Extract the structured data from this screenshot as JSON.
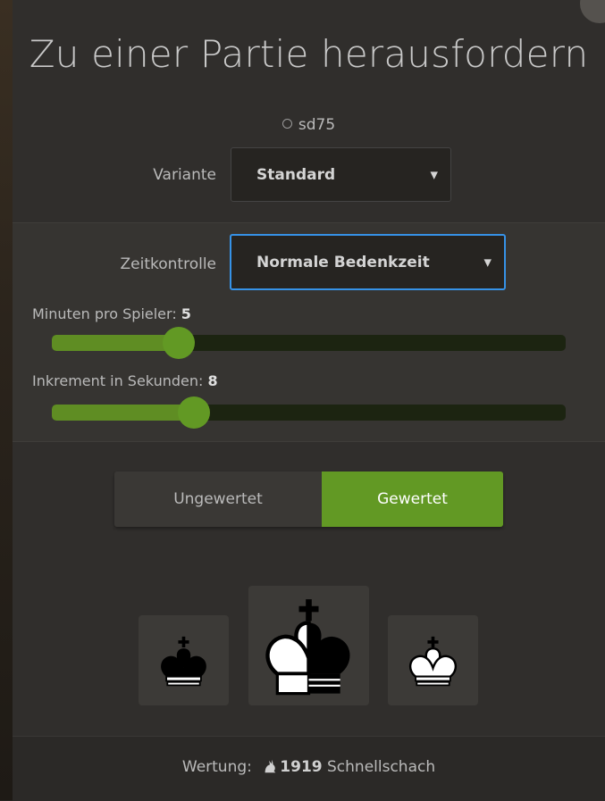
{
  "modal": {
    "title": "Zu einer Partie herausfordern"
  },
  "opponent": {
    "name": "sd75",
    "status_icon": "offline-circle-icon"
  },
  "variant": {
    "label": "Variante",
    "value": "Standard"
  },
  "time_control": {
    "label": "Zeitkontrolle",
    "value": "Normale Bedenkzeit"
  },
  "minutes_slider": {
    "label": "Minuten pro Spieler: ",
    "value": "5",
    "fraction": 0.247
  },
  "increment_slider": {
    "label": "Inkrement in Sekunden: ",
    "value": "8",
    "fraction": 0.276
  },
  "mode": {
    "casual_label": "Ungewertet",
    "rated_label": "Gewertet",
    "selected": "Gewertet"
  },
  "colors": {
    "black_icon": "black-king-icon",
    "random_icon": "half-king-icon",
    "white_icon": "white-king-icon"
  },
  "footer": {
    "prefix": "Wertung: ",
    "icon": "rabbit-icon",
    "rating": "1919",
    "perf": " Schnellschach"
  },
  "theme": {
    "accent": "#629924",
    "focus_border": "#3692e7",
    "background": "#302e2c"
  }
}
